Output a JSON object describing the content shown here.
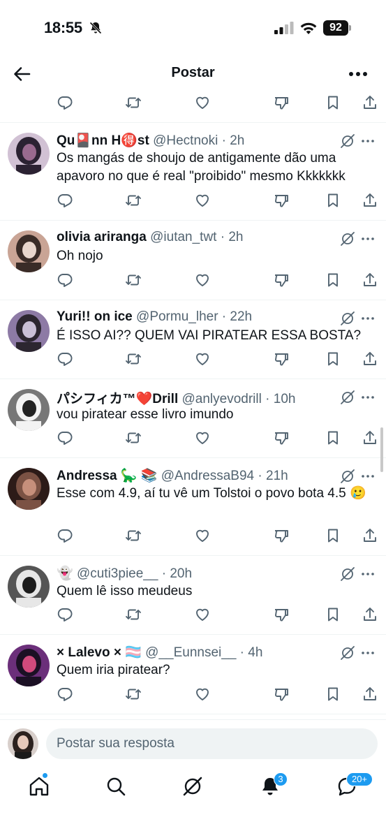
{
  "status": {
    "time": "18:55",
    "battery": "92"
  },
  "header": {
    "title": "Postar",
    "back_icon": "arrow-left-icon",
    "more_icon": "more-horizontal-icon"
  },
  "replies": [
    {
      "name": "Qu🎴nn H🉐st",
      "handle": "@Hectnoki",
      "time": "2h",
      "text": "Os mangás de shoujo de antigamente dão uma apavoro no que é real \"proibido\" mesmo Kkkkkkk",
      "avatar_colors": [
        "#2b2232",
        "#d1c1d4",
        "#9a6a8f"
      ]
    },
    {
      "name": "olivia ariranga",
      "handle": "@iutan_twt",
      "time": "2h",
      "text": "Oh nojo",
      "avatar_colors": [
        "#3a2c27",
        "#c9a495",
        "#e8d6cc"
      ]
    },
    {
      "name": "Yuri!! on ice",
      "handle": "@Pormu_lher",
      "time": "22h",
      "text": "É ISSO AI?? QUEM VAI PIRATEAR ESSA BOSTA?",
      "avatar_colors": [
        "#2c2630",
        "#8d7aa5",
        "#c9bfd6"
      ]
    },
    {
      "name": "パシフィカ™❤️Drill",
      "handle": "@anlyevodrill",
      "time": "10h",
      "text": "vou piratear esse livro imundo",
      "avatar_colors": [
        "#f3f3f3",
        "#777",
        "#222"
      ]
    },
    {
      "name": "Andressa 🦕 📚",
      "handle": "@AndressaB94",
      "time": "21h",
      "text": "Esse com 4.9, aí tu vê um Tolstoi o povo bota 4.5 🥲",
      "avatar_colors": [
        "#7b5244",
        "#2c1b18",
        "#c68f7b"
      ]
    },
    {
      "name": "👻",
      "handle": "@cuti3piee__",
      "time": "20h",
      "text": "Quem lê isso meudeus",
      "avatar_colors": [
        "#e7e7e7",
        "#555",
        "#1c1c1c"
      ]
    },
    {
      "name": "× Lalevo × 🏳️‍⚧️",
      "handle": "@__Eunnsei__",
      "time": "4h",
      "text": "Quem iria piratear?",
      "avatar_colors": [
        "#1b1024",
        "#6b2f7a",
        "#d04a7c"
      ]
    }
  ],
  "reply_bar": {
    "placeholder": "Postar sua resposta"
  },
  "tabs": [
    {
      "icon": "home-icon"
    },
    {
      "icon": "search-icon"
    },
    {
      "icon": "grok-icon"
    },
    {
      "icon": "notifications-icon",
      "badge": "3"
    },
    {
      "icon": "messages-icon",
      "badge": "20+"
    }
  ],
  "colors": {
    "accent": "#1d9bf0",
    "text": "#0f1419",
    "muted": "#536471"
  }
}
